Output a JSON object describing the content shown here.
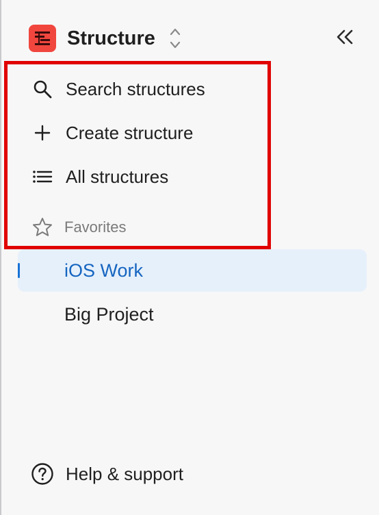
{
  "header": {
    "title": "Structure",
    "logo_icon": "structure-logo-icon",
    "switcher_icon": "chevron-up-down-icon",
    "collapse_icon": "double-chevron-left-icon"
  },
  "nav": {
    "items": [
      {
        "label": "Search structures",
        "icon": "search-icon"
      },
      {
        "label": "Create structure",
        "icon": "plus-icon"
      },
      {
        "label": "All structures",
        "icon": "list-icon"
      }
    ]
  },
  "favorites": {
    "label": "Favorites",
    "icon": "star-icon",
    "items": [
      {
        "label": "iOS Work",
        "active": true
      },
      {
        "label": "Big Project",
        "active": false
      }
    ]
  },
  "footer": {
    "help_label": "Help & support",
    "help_icon": "question-circle-icon"
  },
  "colors": {
    "accent": "#1565c0",
    "active_bg": "#e6f0fb",
    "logo": "#f0463e",
    "highlight": "#e00000"
  }
}
